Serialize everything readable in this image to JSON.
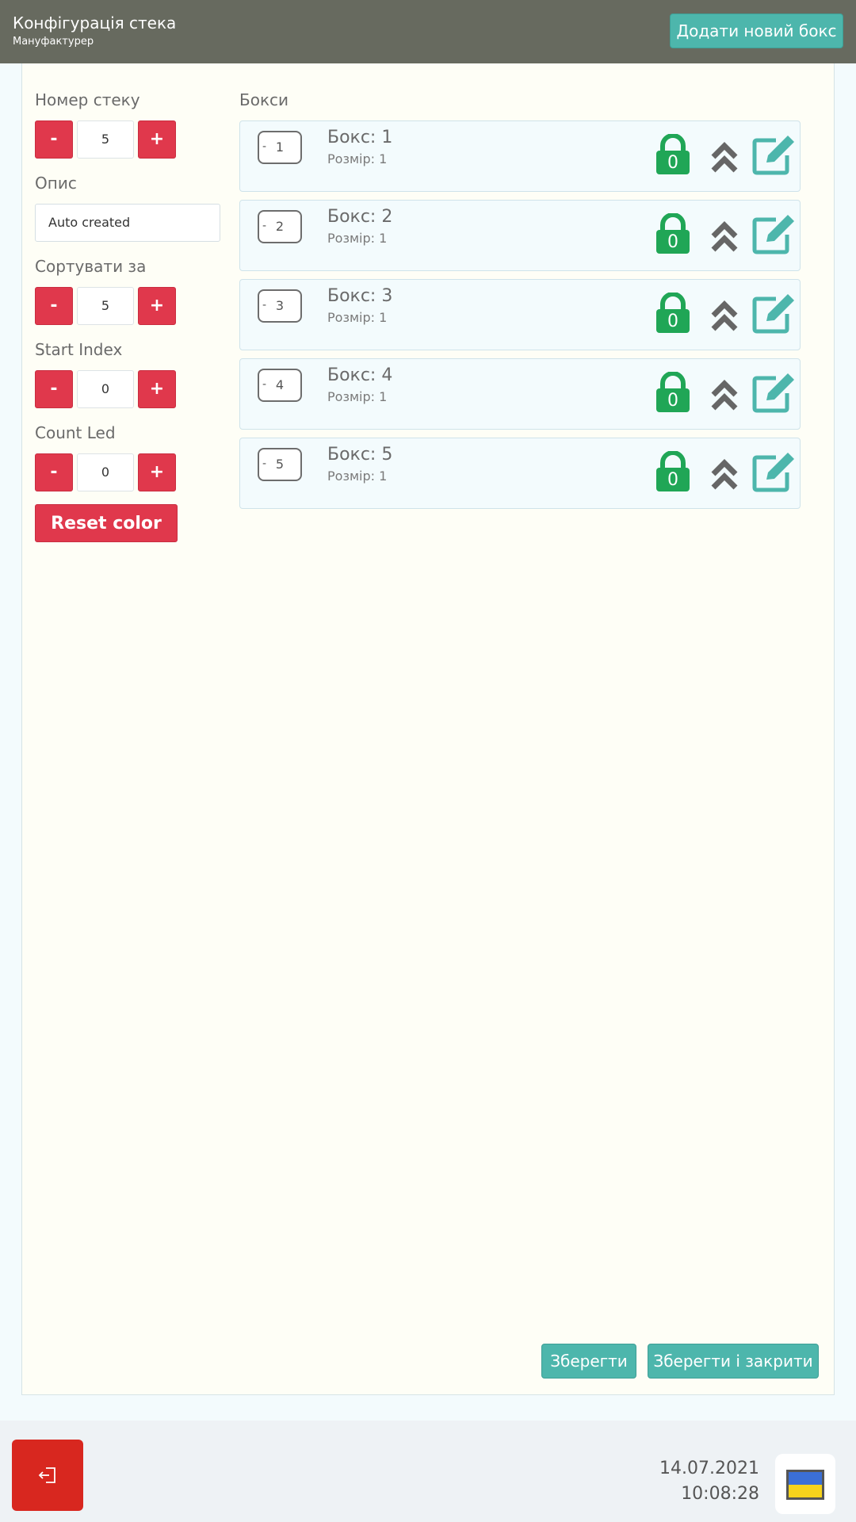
{
  "header": {
    "title": "Конфігурація стека",
    "subtitle": "Мануфактурер",
    "add_box_label": "Додати новий бокс"
  },
  "left": {
    "stack_number_label": "Номер стеку",
    "stack_number_value": "5",
    "description_label": "Опис",
    "description_value": "Auto created",
    "sort_label": "Сортувати за",
    "sort_value": "5",
    "start_index_label": "Start Index",
    "start_index_value": "0",
    "count_led_label": "Count Led",
    "count_led_value": "0",
    "minus_label": "-",
    "plus_label": "+",
    "reset_color_label": "Reset color"
  },
  "boxes": {
    "title": "Бокси",
    "items": [
      {
        "num": "1",
        "name": "Бокс: 1",
        "size": "Розмір: 1",
        "lock_count": "0"
      },
      {
        "num": "2",
        "name": "Бокс: 2",
        "size": "Розмір: 1",
        "lock_count": "0"
      },
      {
        "num": "3",
        "name": "Бокс: 3",
        "size": "Розмір: 1",
        "lock_count": "0"
      },
      {
        "num": "4",
        "name": "Бокс: 4",
        "size": "Розмір: 1",
        "lock_count": "0"
      },
      {
        "num": "5",
        "name": "Бокс: 5",
        "size": "Розмір: 1",
        "lock_count": "0"
      }
    ],
    "dash": "-"
  },
  "actions": {
    "save_label": "Зберегти",
    "save_close_label": "Зберегти і закрити"
  },
  "footer": {
    "date": "14.07.2021",
    "time": "10:08:28"
  },
  "icons": {
    "lock": "lock-icon",
    "chevron": "chevron-double-up-icon",
    "edit": "edit-icon",
    "logout": "logout-icon",
    "flag": "ukraine-flag-icon"
  },
  "colors": {
    "header_bg": "#676a5f",
    "accent_teal": "#4db6ac",
    "danger_red": "#e0384c",
    "lock_green": "#20a656",
    "logout_red": "#d8271f"
  }
}
